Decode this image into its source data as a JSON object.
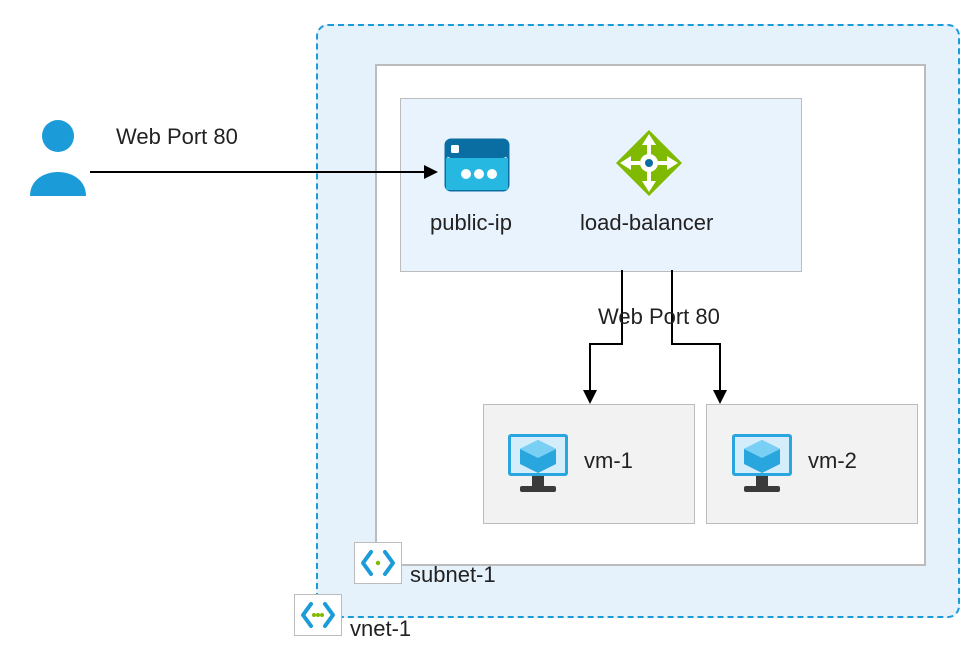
{
  "labels": {
    "user_arrow": "Web Port 80",
    "public_ip": "public-ip",
    "load_balancer": "load-balancer",
    "lb_arrow": "Web Port 80",
    "vm1": "vm-1",
    "vm2": "vm-2",
    "subnet": "subnet-1",
    "vnet": "vnet-1"
  },
  "colors": {
    "azure_blue": "#1b9bd7",
    "azure_dark_blue": "#0a6ea3",
    "green": "#7fba00",
    "gray_border": "#bcbcbc",
    "light_blue_bg": "#e5f1fb",
    "panel_blue": "#e9f3fd",
    "gray_bg": "#f2f2f2"
  }
}
